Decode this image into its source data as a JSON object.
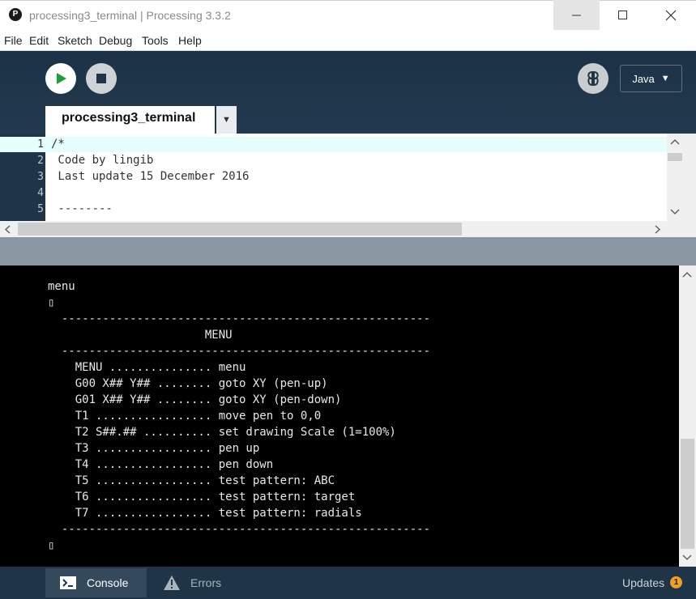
{
  "window": {
    "title": "processing3_terminal | Processing 3.3.2",
    "app_icon_glyph": "P"
  },
  "menubar": {
    "items": [
      "File",
      "Edit",
      "Sketch",
      "Debug",
      "Tools",
      "Help"
    ]
  },
  "toolbar": {
    "mode_label": "Java",
    "mode_arrow": "▼"
  },
  "tabs": {
    "active_label": "processing3_terminal",
    "menu_arrow": "▼"
  },
  "editor": {
    "line_numbers": [
      "1",
      "2",
      "3",
      "4",
      "5"
    ],
    "lines": [
      "/*",
      " Code by lingib",
      " Last update 15 December 2016",
      "",
      " --------"
    ]
  },
  "console": {
    "lines": [
      "menu",
      "▯",
      "  ------------------------------------------------------",
      "                       MENU",
      "  ------------------------------------------------------",
      "    MENU ............... menu",
      "    G00 X## Y## ........ goto XY (pen-up)",
      "    G01 X## Y## ........ goto XY (pen-down)",
      "    T1 ................. move pen to 0,0",
      "    T2 S##.## .......... set drawing Scale (1=100%)",
      "    T3 ................. pen up",
      "    T4 ................. pen down",
      "    T5 ................. test pattern: ABC",
      "    T6 ................. test pattern: target",
      "    T7 ................. test pattern: radials",
      "  ------------------------------------------------------",
      "▯"
    ]
  },
  "statusbar": {
    "console_label": "Console",
    "errors_label": "Errors",
    "updates_label": "Updates",
    "updates_count": "1"
  },
  "colors": {
    "toolbar_bg": "#1f3447",
    "run_icon": "#1f9d3a",
    "current_line": "#e6fffd",
    "console_bg": "#000000",
    "updates_badge": "#f0a020"
  }
}
